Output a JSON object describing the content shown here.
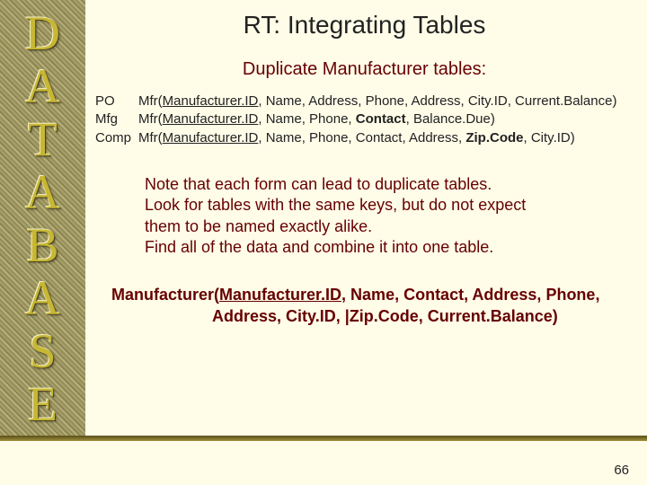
{
  "sidebar": {
    "letters": [
      "D",
      "A",
      "T",
      "A",
      "B",
      "A",
      "S",
      "E"
    ]
  },
  "title": "RT: Integrating Tables",
  "subtitle": "Duplicate Manufacturer tables:",
  "schema": {
    "rows": [
      {
        "prefix": "PO",
        "fn": "Mfr(",
        "key": "Manufacturer.ID",
        "rest": ", Name, Address, Phone, Address, City.ID, Current.Balance)"
      },
      {
        "prefix": "Mfg",
        "fn": "Mfr(",
        "key": "Manufacturer.ID",
        "rest1": ", Name, Phone, ",
        "bold": "Contact",
        "rest2": ", Balance.Due)"
      },
      {
        "prefix": "Comp",
        "fn": "Mfr(",
        "key": "Manufacturer.ID",
        "rest1": ", Name, Phone, Contact, Address, ",
        "bold": "Zip.Code",
        "rest2": ", City.ID)"
      }
    ]
  },
  "note": {
    "l1": "Note that each form can lead to duplicate tables.",
    "l2": "Look for tables with the same keys, but do not expect",
    "l3": "them to be named exactly alike.",
    "l4": "Find all of the data and combine it into one table."
  },
  "result": {
    "p1a": "Manufacturer(",
    "p1key": "Manufacturer.ID",
    "p1b": ", Name, Contact, Address, Phone,",
    "p2": "Address, City.ID, |Zip.Code, Current.Balance)"
  },
  "page": "66"
}
